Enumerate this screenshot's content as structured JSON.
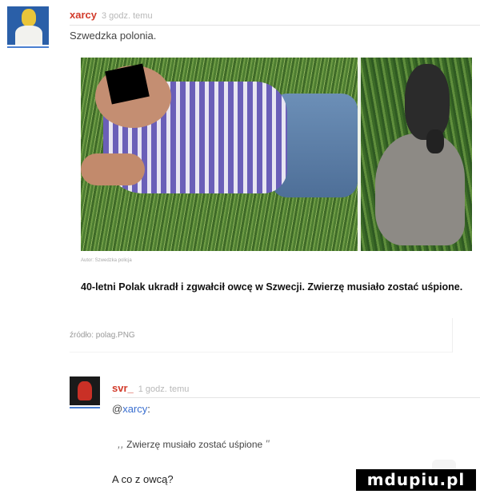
{
  "comment1": {
    "author": "xarcy",
    "time": "3 godz. temu",
    "text": "Szwedzka polonia."
  },
  "embed": {
    "photo_credit": "Autor: Szwedzka policja",
    "headline": "40-letni Polak ukradł i zgwałcił owcę w Szwecji. Zwierzę musiało zostać uśpione.",
    "source": "źródło: polag.PNG"
  },
  "comment2": {
    "author": "svr_",
    "time": "1 godz. temu",
    "mention_at": "@",
    "mention_name": "xarcy",
    "mention_colon": ":",
    "quote_open": ",,",
    "quote": "Zwierzę musiało zostać uśpione",
    "quote_close": "\"",
    "text": "A co z owcą?"
  },
  "watermark": {
    "text": "mdupiu.pl"
  },
  "colors": {
    "author": "#d23b2b",
    "mention": "#3a6fd0",
    "avatar_underline": "#4a7fd0"
  }
}
